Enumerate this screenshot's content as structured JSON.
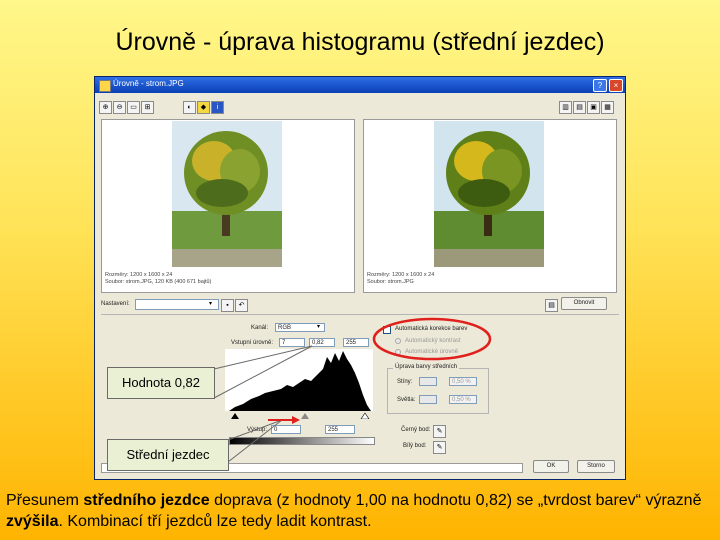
{
  "slide": {
    "title": "Úrovně - úprava histogramu (střední jezdec)",
    "caption_parts": [
      "Přesunem ",
      "středního jezdce",
      " doprava (z hodnoty 1,00 na hodnotu 0,82) se „tvrdost barev“ výrazně ",
      "zvýšila",
      ". Kombinací tří jezdců lze tedy ladit kontrast."
    ]
  },
  "dialog": {
    "title": "Úrovně - strom.JPG",
    "left_info": [
      "Rozměry: 1200 x 1600 x 24",
      "Soubor: strom.JPG, 120 KB (400 671 bajtů)"
    ],
    "right_info": [
      "Rozměry: 1200 x 1600 x 24",
      "Soubor: strom.JPG"
    ],
    "preset_label": "Nastavení:",
    "preset_value": "",
    "channel_label": "Kanál:",
    "channel_value": "RGB",
    "input_label": "Vstupní úrovně:",
    "input_values": [
      "7",
      "0,82",
      "255"
    ],
    "output_label": "Výstup:",
    "output_values": [
      "0",
      "255"
    ],
    "auto_label": "Automatická korekce barev",
    "auto_opt1": "Automatický kontrast",
    "auto_opt2": "Automatické úrovně",
    "mid_group": "Úprava barvy středních",
    "shadows_label": "Stíny:",
    "shadows_value": "0,50 %",
    "highlights_label": "Světla:",
    "highlights_value": "0,50 %",
    "black_point_label": "Černý bod:",
    "white_point_label": "Bílý bod:",
    "reset_label": "Obnovit",
    "ok_label": "OK",
    "cancel_label": "Storno"
  },
  "callouts": {
    "value": "Hodnota 0,82",
    "slider": "Střední jezdec"
  },
  "colors": {
    "highlight_ellipse": "#e0201c",
    "arrow": "#e0201c",
    "titlebar": "#0a3fb4"
  }
}
